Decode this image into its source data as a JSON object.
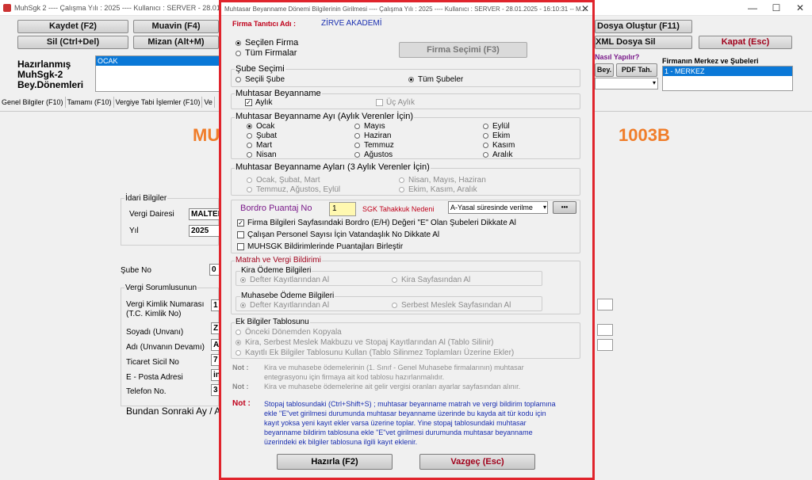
{
  "main_window": {
    "title": "MuhSgk 2  ----  Çalışma Yılı : 2025   ----   Kullanıcı : SERVER - 28.01.2025 - 16",
    "buttons": {
      "kaydet": "Kaydet (F2)",
      "muavin": "Muavin (F4)",
      "sil": "Sil (Ctrl+Del)",
      "mizan": "Mizan (Alt+M)",
      "dosya_olustur": "Dosya Oluştur (F11)",
      "xml_sil": "XML Dosya Sil",
      "kapat": "Kapat (Esc)",
      "nasil": "Nasıl Yapılır?",
      "bey": "Bey.",
      "pdf": "PDF Tah."
    },
    "left_labels": [
      "Hazırlanmış",
      "MuhSgk-2",
      "Bey.Dönemleri"
    ],
    "period_list_selected": "OCAK",
    "branches_title": "Firmanın Merkez ve Şubeleri",
    "branch_selected": "1 - MERKEZ",
    "tabs": [
      "Genel Bilgiler (F10)",
      "Tamamı (F10)",
      "Vergiye Tabi İşlemler (F10)",
      "Ve"
    ],
    "big_text_left": "MU",
    "big_text_right": "1003B",
    "idari_title": "İdari Bilgiler",
    "vergi_dairesi_label": "Vergi Dairesi",
    "vergi_dairesi_value": "MALTEP",
    "yil_label": "Yıl",
    "yil_value": "2025",
    "sube_no_label": "Şube No",
    "sube_no_value": "0",
    "vergi_sorumlusu_title": "Vergi Sorumlusunun",
    "fields": [
      {
        "label": "Vergi Kimlik Numarası",
        "value": "1"
      },
      {
        "label": "(T.C. Kimlik No)",
        "value": ""
      },
      {
        "label": "Soyadı (Unvanı)",
        "value": "Z"
      },
      {
        "label": "Adı (Unvanın Devamı)",
        "value": "A"
      },
      {
        "label": "Ticaret Sicil No",
        "value": "7"
      },
      {
        "label": "E - Posta Adresi",
        "value": "in"
      },
      {
        "label": "Telefon No.",
        "value": "3"
      }
    ],
    "bottom_label": "Bundan Sonraki Ay / Ayla"
  },
  "dialog": {
    "title": "Muhtasar Beyanname Dönemi Bilgilerinin Girilmesi   ----   Çalışma Yılı : 2025   ----   Kullanıcı : SERVER - 28.01.2025 - 16:10:31 -- M...",
    "firma_label": "Firma Tanıtıcı Adı :",
    "firma_value": "ZİRVE AKADEMİ",
    "secilen_firma": "Seçilen Firma",
    "tum_firmalar": "Tüm Firmalar",
    "firma_secimi_button": "Firma Seçimi (F3)",
    "sube_secimi_title": "Şube Seçimi",
    "secili_sube": "Seçili Şube",
    "tum_subeler": "Tüm Şubeler",
    "muhtasar_title": "Muhtasar Beyanname",
    "aylik": "Aylık",
    "uc_aylik": "Üç Aylık",
    "aylik_title": "Muhtasar Beyanname Ayı (Aylık Verenler İçin)",
    "months": [
      "Ocak",
      "Şubat",
      "Mart",
      "Nisan",
      "Mayıs",
      "Haziran",
      "Temmuz",
      "Ağustos",
      "Eylül",
      "Ekim",
      "Kasım",
      "Aralık"
    ],
    "selected_month": "Ocak",
    "quarter_title": "Muhtasar  Beyanname Ayları (3 Aylık Verenler İçin)",
    "quarters": [
      "Ocak, Şubat, Mart",
      "Nisan, Mayıs, Haziran",
      "Temmuz, Ağustos, Eylül",
      "Ekim, Kasım, Aralık"
    ],
    "bordro_label": "Bordro Puantaj No",
    "bordro_value": "1",
    "sgk_label": "SGK Tahakkuk Nedeni",
    "sgk_value": "A-Yasal süresinde verilme",
    "dots_button": "•••",
    "check1": "Firma Bilgileri Sayfasındaki Bordro (E/H) Değeri \"E\" Olan Şubeleri Dikkate Al",
    "check2": "Çalışan Personel Sayısı İçin Vatandaşlık No Dikkate Al",
    "check3": "MUHSGK Bildirimlerinde Puantajları Birleştir",
    "matrah_title": "Matrah ve Vergi Bildirimi",
    "kira_title": "Kira Ödeme Bilgileri",
    "defter_kira": "Defter Kayıtlarından Al",
    "kira_sayfasi": "Kira Sayfasından Al",
    "muhasebe_title": "Muhasebe Ödeme Bilgileri",
    "defter_muh": "Defter Kayıtlarından Al",
    "serbest_meslek": "Serbest Meslek Sayfasından Al",
    "ek_title": "Ek Bilgiler Tablosunu",
    "ek_opt1": "Önceki Dönemden Kopyala",
    "ek_opt2": "Kira, Serbest Meslek Makbuzu ve Stopaj Kayıtlarından Al (Tablo Silinir)",
    "ek_opt3": "Kayıtlı Ek Bilgiler Tablosunu Kullan (Tablo Silinmez Toplamları Üzerine Ekler)",
    "not_label": "Not :",
    "note1_line1": "Kira ve muhasebe ödemelerinin (1. Sınıf - Genel Muhasebe firmalarının) muhtasar",
    "note1_line2": "entegrasyonu için firmaya ait kod tablosu hazırlanmalıdır.",
    "note2": "Kira ve muhasebe ödemelerine ait gelir vergisi oranları ayarlar sayfasından alınır.",
    "note3_lines": [
      "Stopaj tablosundaki (Ctrl+Shift+S) ; muhtasar beyanname matrah ve vergi bildirim toplamına",
      "ekle \"E\"vet girilmesi durumunda muhtasar beyanname üzerinde bu kayda ait tür kodu için",
      "kayıt yoksa yeni kayıt ekler varsa üzerine toplar. Yine stopaj tablosundaki muhtasar",
      "beyanname bildirim tablosuna ekle \"E\"vet girilmesi durumunda muhtasar beyanname",
      "üzerindeki ek bilgiler tablosuna ilgili kayıt eklenir."
    ],
    "hazirla_button": "Hazırla (F2)",
    "vazgec_button": "Vazgeç (Esc)"
  },
  "colors": {
    "dialog_border": "#e0242c",
    "blue_text": "#1a2fb0",
    "red_text": "#c0001a",
    "selection": "#0a78d7",
    "orange": "#f07d2a"
  }
}
